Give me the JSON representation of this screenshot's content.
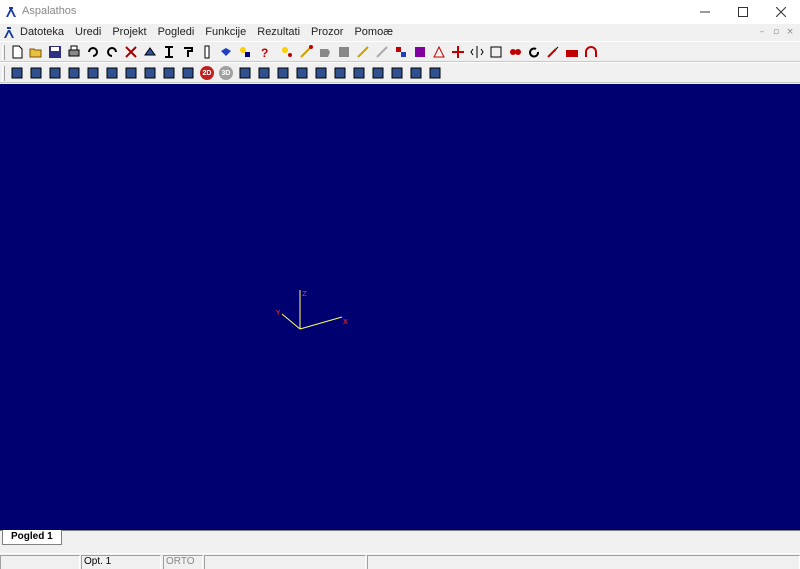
{
  "window": {
    "title": "Aspalathos",
    "minimize_icon": "minimize-icon",
    "maximize_icon": "maximize-icon",
    "close_icon": "close-icon"
  },
  "menu": {
    "items": [
      "Datoteka",
      "Uredi",
      "Projekt",
      "Pogledi",
      "Funkcije",
      "Rezultati",
      "Prozor",
      "Pomoæ"
    ]
  },
  "toolbar1": {
    "icons": [
      "new-file-icon",
      "open-folder-icon",
      "save-icon",
      "print-icon",
      "undo-icon",
      "redo-icon",
      "tools-icon",
      "mesh-icon",
      "i-beam-icon",
      "section-icon",
      "column-icon",
      "material-icon",
      "load-icon",
      "help-icon",
      "node-icon",
      "line-icon",
      "area-icon",
      "plate-icon",
      "support-icon",
      "hinge-icon",
      "node-support-icon",
      "area-select-icon",
      "triangle-icon",
      "move-icon",
      "mirror-icon",
      "scale-icon",
      "copy-icon",
      "rotate-icon",
      "pen-icon",
      "wall-icon",
      "arch-icon"
    ]
  },
  "toolbar2": {
    "icons": [
      "view-edit-icon",
      "view-list-icon",
      "view-section-icon",
      "view-frame-icon",
      "pan-icon",
      "zoom-icon",
      "zoom-window-icon",
      "zoom-extents-icon",
      "zoom-out-icon",
      "rotate-view-icon",
      "view-2d-icon",
      "view-3d-icon",
      "render-icon",
      "solid-icon",
      "select-node-icon",
      "select-bar-icon",
      "select-line-icon",
      "select-area-icon",
      "select-group-icon",
      "select-point-icon",
      "select-load-icon",
      "select-ext-icon",
      "select-shell-icon"
    ],
    "label_2d": "2D",
    "label_3d": "3D"
  },
  "viewport": {
    "background": "#000070",
    "axis_x_label": "X",
    "axis_y_label": "Y",
    "axis_z_label": "Z"
  },
  "tabs": [
    "Pogled 1"
  ],
  "status": {
    "panes": [
      "",
      "Opt. 1",
      "ORTO",
      "",
      ""
    ]
  }
}
